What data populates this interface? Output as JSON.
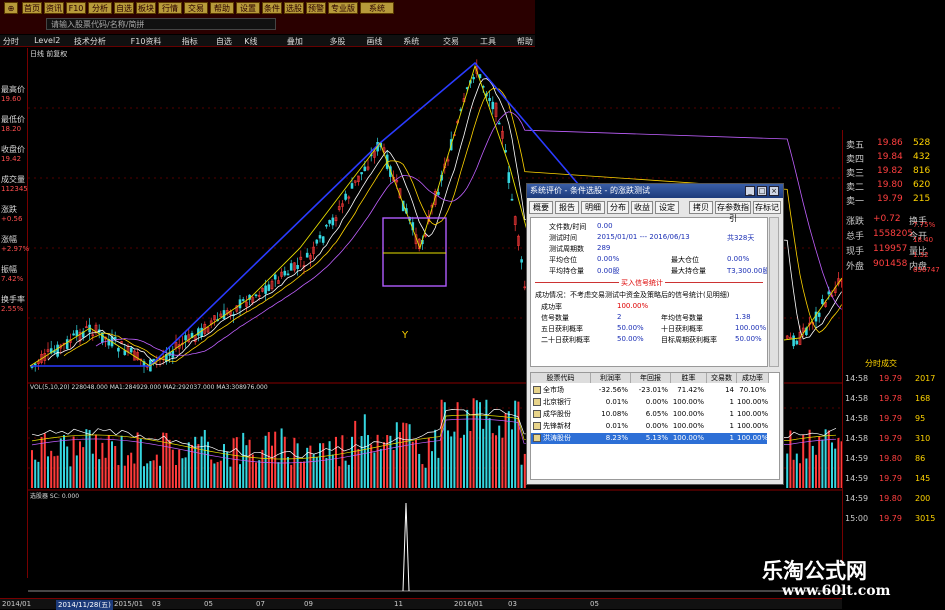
{
  "toolbar": {
    "buttons": [
      "首页",
      "资讯",
      "F10",
      "分析",
      "自选",
      "板块",
      "行情",
      "交易",
      "帮助",
      "设置",
      "条件",
      "选股",
      "预警",
      "专业版",
      "系统"
    ],
    "search_placeholder": "请输入股票代码/名称/简拼"
  },
  "menubar": [
    "分时",
    "Level2",
    "技术分析",
    "F10资料",
    "指标",
    "自选",
    "K线",
    "叠加",
    "多股",
    "画线",
    "系统",
    "交易",
    "工具",
    "帮助"
  ],
  "left_panel": {
    "labels": [
      "最高价",
      "最低价",
      "收盘价",
      "成交量",
      "涨跌",
      "涨幅",
      "振幅",
      "换手率"
    ],
    "values": [
      "19.60",
      "18.20",
      "19.42",
      "112345",
      "+0.56",
      "+2.97%",
      "7.42%",
      "2.55%"
    ]
  },
  "chart_header": "日线 前复权",
  "volume_header": "VOL(5,10,20) 228048.000 MA1:284929.000 MA2:292037.000 MA3:308976.000",
  "indicator_header": "选股器 SC: 0.000",
  "y_axis_price": [
    "18.20",
    "15.70",
    "13.20",
    "10.70",
    "8.20"
  ],
  "y_axis_volume": [
    "22198",
    "11119"
  ],
  "price_marks": {
    "low": "5.59",
    "cursor": "Y"
  },
  "right_panel": {
    "order_book": [
      {
        "label": "卖五",
        "price": "19.86",
        "vol": "528"
      },
      {
        "label": "卖四",
        "price": "19.84",
        "vol": "432"
      },
      {
        "label": "卖三",
        "price": "19.82",
        "vol": "816"
      },
      {
        "label": "卖二",
        "price": "19.80",
        "vol": "620"
      },
      {
        "label": "卖一",
        "price": "19.79",
        "vol": "215"
      }
    ],
    "stats": [
      {
        "label": "涨跌",
        "v1": "+0.72",
        "l2": "换手",
        "v2": "7.75%"
      },
      {
        "label": "总手",
        "v1": "1558205",
        "l2": "今开",
        "v2": "18.40"
      },
      {
        "label": "现手",
        "v1": "119957",
        "l2": "量比",
        "v2": "1.32"
      },
      {
        "label": "外盘",
        "v1": "901458",
        "l2": "内盘",
        "v2": "656747"
      }
    ],
    "trades_header": "分时成交",
    "trades": [
      {
        "time": "14:58",
        "price": "19.79",
        "vol": "2017"
      },
      {
        "time": "14:58",
        "price": "19.78",
        "vol": "168"
      },
      {
        "time": "14:58",
        "price": "19.79",
        "vol": "95"
      },
      {
        "time": "14:58",
        "price": "19.79",
        "vol": "310"
      },
      {
        "time": "14:59",
        "price": "19.80",
        "vol": "86"
      },
      {
        "time": "14:59",
        "price": "19.79",
        "vol": "145"
      },
      {
        "time": "14:59",
        "price": "19.80",
        "vol": "200"
      },
      {
        "time": "15:00",
        "price": "19.79",
        "vol": "3015"
      }
    ]
  },
  "dialog": {
    "title": "系统评价 - 条件选股 - 的涨跌测试",
    "tabs": [
      "概要",
      "报告",
      "明细",
      "分布",
      "收益",
      "设定",
      "拷贝",
      "存参数指引",
      "存标记"
    ],
    "lines": [
      {
        "k": "文件数/时间",
        "v": "0.00",
        "v2": ""
      },
      {
        "k": "测试时间",
        "v": "2015/01/01 --- 2016/06/13",
        "v2": "共328天"
      },
      {
        "k": "测试周期数",
        "v": "289",
        "v2": ""
      },
      {
        "k": "平均仓位",
        "v": "0.00%",
        "k2": "最大仓位",
        "v2": "0.00%"
      },
      {
        "k": "平均持仓量",
        "v": "0.00股",
        "k2": "最大持仓量",
        "v2": "T3,300.00股"
      }
    ],
    "section_title": "买入信号统计",
    "section_note": "成功情况：不考虑交易测试中资金及策略后的信号统计(见明细)",
    "stats": [
      {
        "k": "成功率",
        "v": "100.00%",
        "k2": "",
        "v2": ""
      },
      {
        "k": "信号数量",
        "v": "2",
        "k2": "年均信号数量",
        "v2": "1.38"
      },
      {
        "k": "五日获利概率",
        "v": "50.00%",
        "k2": "十日获利概率",
        "v2": "100.00%"
      },
      {
        "k": "二十日获利概率",
        "v": "50.00%",
        "k2": "目标周期获利概率",
        "v2": "50.00%"
      }
    ],
    "grid_headers": [
      "股票代码",
      "利润率",
      "年回报",
      "胜率",
      "交易数",
      "成功率"
    ],
    "grid_rows": [
      {
        "name": "全市场",
        "profit": "-32.56%",
        "annual": "-23.01%",
        "win": "71.42%",
        "trades": "14",
        "success": "70.10%"
      },
      {
        "name": "北京银行",
        "profit": "0.01%",
        "annual": "0.00%",
        "win": "100.00%",
        "trades": "1",
        "success": "100.00%"
      },
      {
        "name": "成华股份",
        "profit": "10.08%",
        "annual": "6.05%",
        "win": "100.00%",
        "trades": "1",
        "success": "100.00%"
      },
      {
        "name": "先锋新材",
        "profit": "0.01%",
        "annual": "0.00%",
        "win": "100.00%",
        "trades": "1",
        "success": "100.00%"
      },
      {
        "name": "洪涛股份",
        "profit": "8.23%",
        "annual": "5.13%",
        "win": "100.00%",
        "trades": "1",
        "success": "100.00%"
      }
    ]
  },
  "bottom_bar": [
    "2014/01",
    "2014/11/28(五)",
    "2015/01",
    "03",
    "05",
    "07",
    "09",
    "11",
    "2016/01",
    "03",
    "05"
  ],
  "watermark": {
    "line1": "乐淘公式网",
    "line2": "www.60lt.com"
  },
  "colors": {
    "up": "#ff3b3b",
    "down": "#35d6e0",
    "trend": "#2a3bff",
    "ma1": "#ffffff",
    "ma2": "#ffd400",
    "ma3": "#c060ff",
    "box": "#b05cff"
  }
}
